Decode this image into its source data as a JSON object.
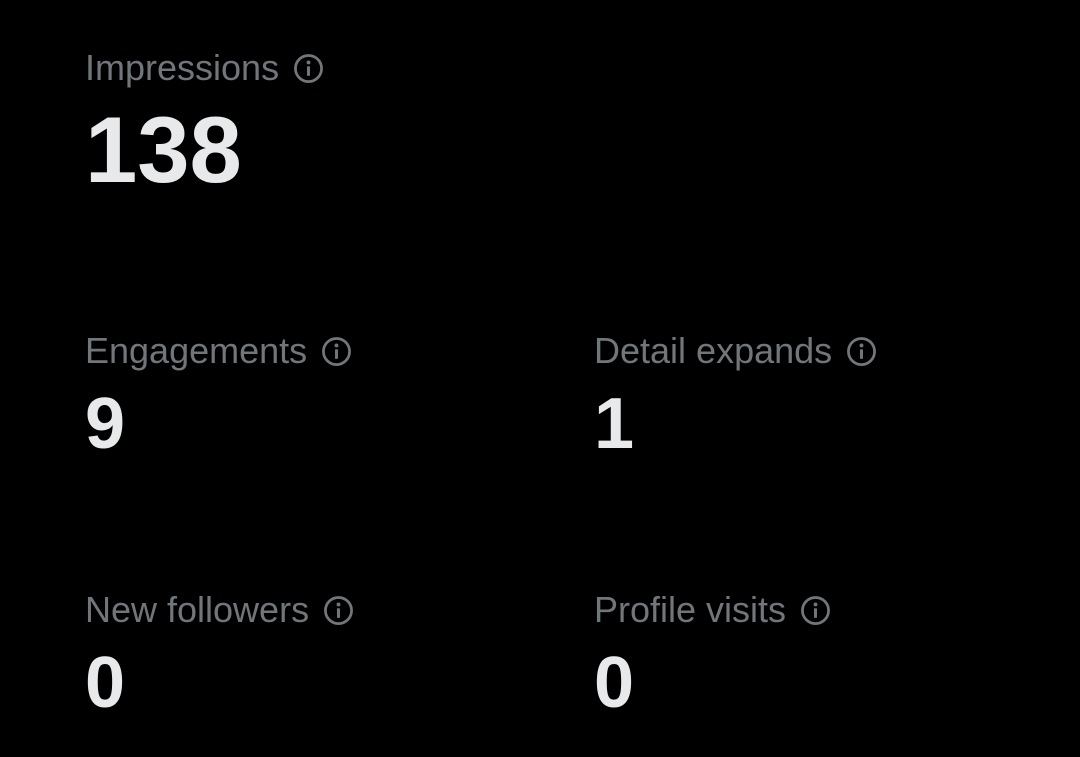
{
  "metrics": {
    "impressions": {
      "label": "Impressions",
      "value": "138",
      "icon": "info-icon"
    },
    "engagements": {
      "label": "Engagements",
      "value": "9",
      "icon": "info-icon"
    },
    "detail_expands": {
      "label": "Detail expands",
      "value": "1",
      "icon": "info-icon"
    },
    "new_followers": {
      "label": "New followers",
      "value": "0",
      "icon": "info-icon"
    },
    "profile_visits": {
      "label": "Profile visits",
      "value": "0",
      "icon": "info-icon"
    }
  },
  "colors": {
    "background": "#000000",
    "label": "#71767b",
    "value": "#e7e9ea"
  }
}
